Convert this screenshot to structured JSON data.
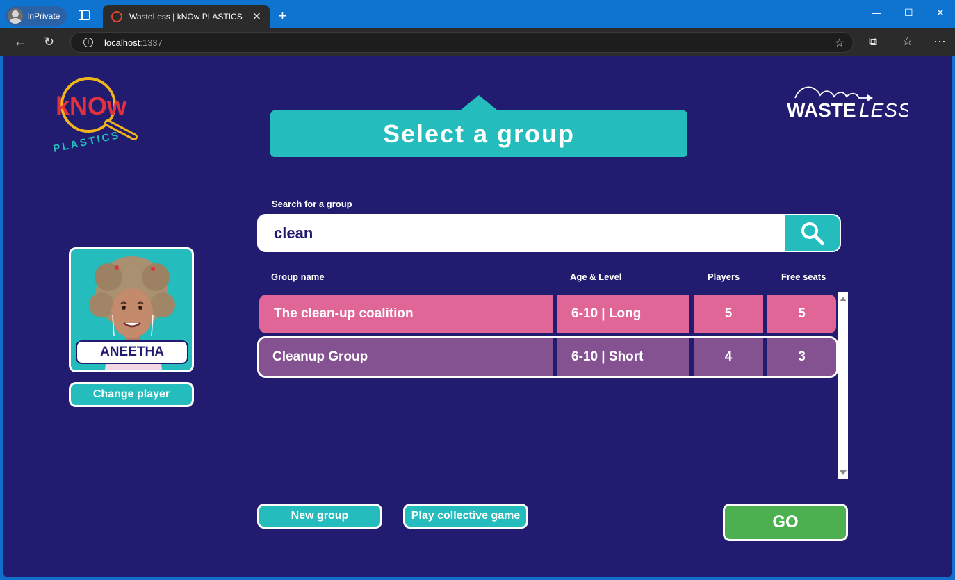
{
  "browser": {
    "profile_label": "InPrivate",
    "tab_title": "WasteLess | kNOw PLASTICS",
    "url_host": "localhost",
    "url_port": ":1337"
  },
  "logos": {
    "know_top": "kNOw",
    "know_bottom": "PLASTICS",
    "waste": "WASTE",
    "less": "LESS"
  },
  "page": {
    "title": "Select a group"
  },
  "search": {
    "label": "Search for a group",
    "value": "clean"
  },
  "table": {
    "columns": [
      "Group name",
      "Age & Level",
      "Players",
      "Free seats"
    ],
    "rows": [
      {
        "name": "The clean-up coalition",
        "age_level": "6-10 | Long",
        "players": "5",
        "free_seats": "5"
      },
      {
        "name": "Cleanup Group",
        "age_level": "6-10 | Short",
        "players": "4",
        "free_seats": "3"
      }
    ]
  },
  "player": {
    "name": "ANEETHA",
    "change_label": "Change player"
  },
  "actions": {
    "new_group": "New group",
    "collective": "Play collective game",
    "go": "GO"
  },
  "colors": {
    "background": "#211c6f",
    "teal": "#24bcbc",
    "row_highlight": "#e06698",
    "row_selected": "#845291",
    "go_green": "#4caf50"
  }
}
